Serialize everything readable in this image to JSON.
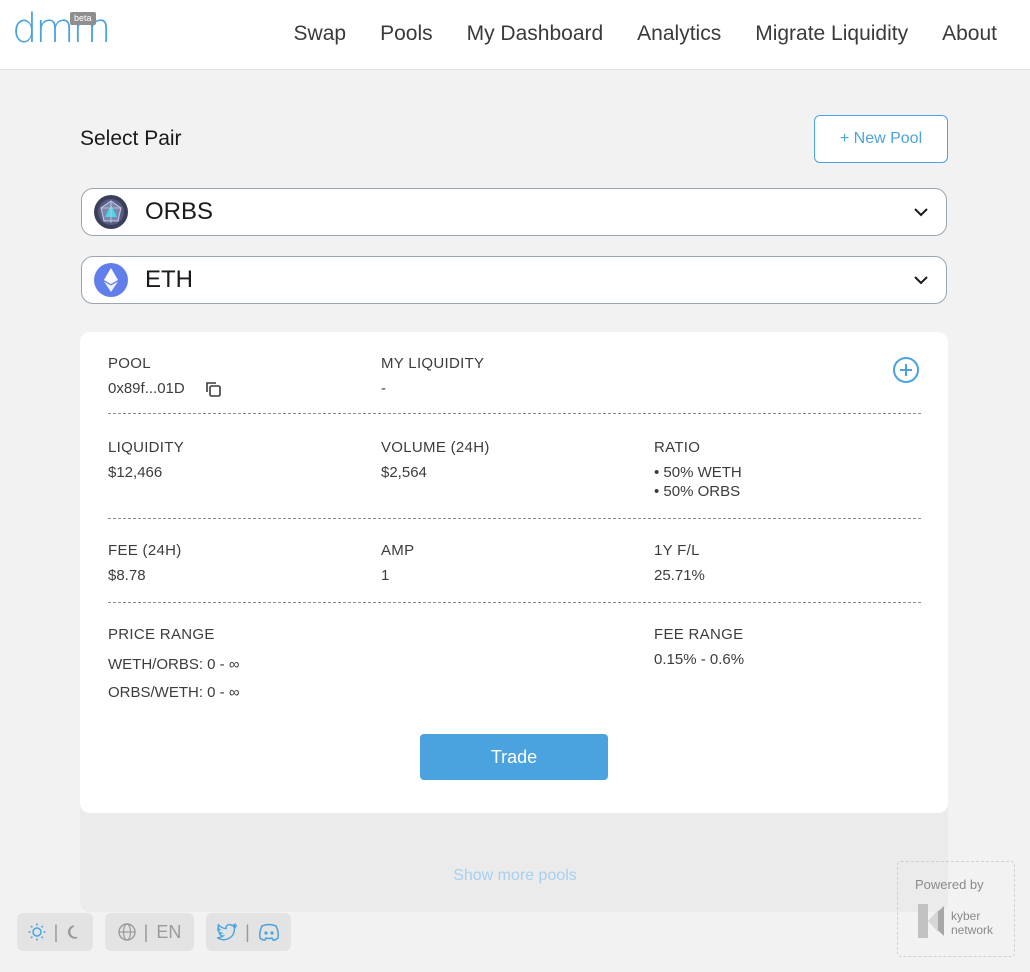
{
  "header": {
    "logo_text": "dmm",
    "logo_badge": "beta",
    "nav": [
      "Swap",
      "Pools",
      "My Dashboard",
      "Analytics",
      "Migrate Liquidity",
      "About"
    ]
  },
  "page": {
    "title": "Select Pair",
    "new_pool_label": "+ New Pool"
  },
  "pair": {
    "token_a": "ORBS",
    "token_b": "ETH"
  },
  "pool": {
    "pool_label": "POOL",
    "pool_address": "0x89f...01D",
    "my_liquidity_label": "MY LIQUIDITY",
    "my_liquidity_value": "-",
    "liquidity_label": "LIQUIDITY",
    "liquidity_value": "$12,466",
    "volume_label": "VOLUME (24H)",
    "volume_value": "$2,564",
    "ratio_label": "RATIO",
    "ratio_a": "• 50% WETH",
    "ratio_b": "• 50% ORBS",
    "fee_label": "FEE (24H)",
    "fee_value": "$8.78",
    "amp_label": "AMP",
    "amp_value": "1",
    "fl_label": "1Y F/L",
    "fl_value": "25.71%",
    "price_range_label": "PRICE RANGE",
    "price_range_a": "WETH/ORBS: 0 - ∞",
    "price_range_b": "ORBS/WETH: 0 - ∞",
    "fee_range_label": "FEE RANGE",
    "fee_range_value": "0.15% - 0.6%",
    "trade_label": "Trade"
  },
  "show_more_label": "Show more pools",
  "footer": {
    "language": "EN",
    "powered_by": "Powered by",
    "kyber_line1": "kyber",
    "kyber_line2": "network"
  },
  "colors": {
    "accent": "#4aa3df",
    "background": "#f2f2f2"
  }
}
